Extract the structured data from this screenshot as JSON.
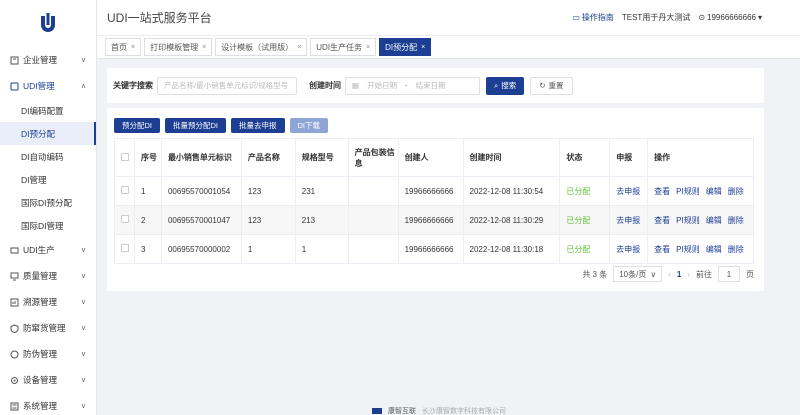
{
  "app": {
    "title": "UDI一站式服务平台"
  },
  "header": {
    "guide_label": "操作指南",
    "tenant": "TEST用于丹大测试",
    "user_phone": "19966666666"
  },
  "sidebar": {
    "items": [
      {
        "label": "企业管理"
      },
      {
        "label": "UDI管理"
      },
      {
        "label": "UDI生产"
      },
      {
        "label": "质量管理"
      },
      {
        "label": "溯源管理"
      },
      {
        "label": "防窜货管理"
      },
      {
        "label": "防伪管理"
      },
      {
        "label": "设备管理"
      },
      {
        "label": "系统管理"
      }
    ],
    "sub_items": [
      "DI编码配置",
      "DI预分配",
      "DI自动编码",
      "DI管理",
      "国际DI预分配",
      "国际DI管理"
    ]
  },
  "tabs": [
    "首页",
    "打印模板管理",
    "设计模板（试用版）",
    "UDI生产任务",
    "DI预分配"
  ],
  "search": {
    "keyword_label": "关键字搜索",
    "keyword_placeholder": "产品名称/最小销售单元标识/规格型号",
    "date_label": "创建时间",
    "start_placeholder": "开始日期",
    "date_sep": "-",
    "end_placeholder": "结束日期",
    "search_label": "搜索",
    "reset_label": "重置"
  },
  "toolbar": {
    "prealloc": "预分配DI",
    "batch_prealloc": "批量预分配DI",
    "batch_report": "批量去申报",
    "download": "DI下载"
  },
  "table": {
    "headers": [
      "序号",
      "最小销售单元标识",
      "产品名称",
      "规格型号",
      "产品包装信息",
      "创建人",
      "创建时间",
      "状态",
      "申报",
      "操作"
    ],
    "rows": [
      {
        "idx": "1",
        "di": "00695570001054",
        "name": "123",
        "model": "231",
        "pack": "",
        "creator": "19966666666",
        "time": "2022-12-08 11:30:54",
        "status": "已分配",
        "report": "去申报"
      },
      {
        "idx": "2",
        "di": "00695570001047",
        "name": "123",
        "model": "213",
        "pack": "",
        "creator": "19966666666",
        "time": "2022-12-08 11:30:29",
        "status": "已分配",
        "report": "去申报"
      },
      {
        "idx": "3",
        "di": "00695570000002",
        "name": "1",
        "model": "1",
        "pack": "",
        "creator": "19966666666",
        "time": "2022-12-08 11:30:18",
        "status": "已分配",
        "report": "去申报"
      }
    ],
    "actions": [
      "查看",
      "PI规则",
      "编辑",
      "删除"
    ]
  },
  "pager": {
    "total": "共 3 条",
    "page_size": "10条/页",
    "current": "1",
    "goto_label": "前往",
    "goto_value": "1",
    "page_unit": "页"
  },
  "footer": {
    "brand": "康智互联",
    "company": "长沙康智数字科技有限公司"
  },
  "colors": {
    "primary": "#1c3f94",
    "success": "#67c23a"
  }
}
